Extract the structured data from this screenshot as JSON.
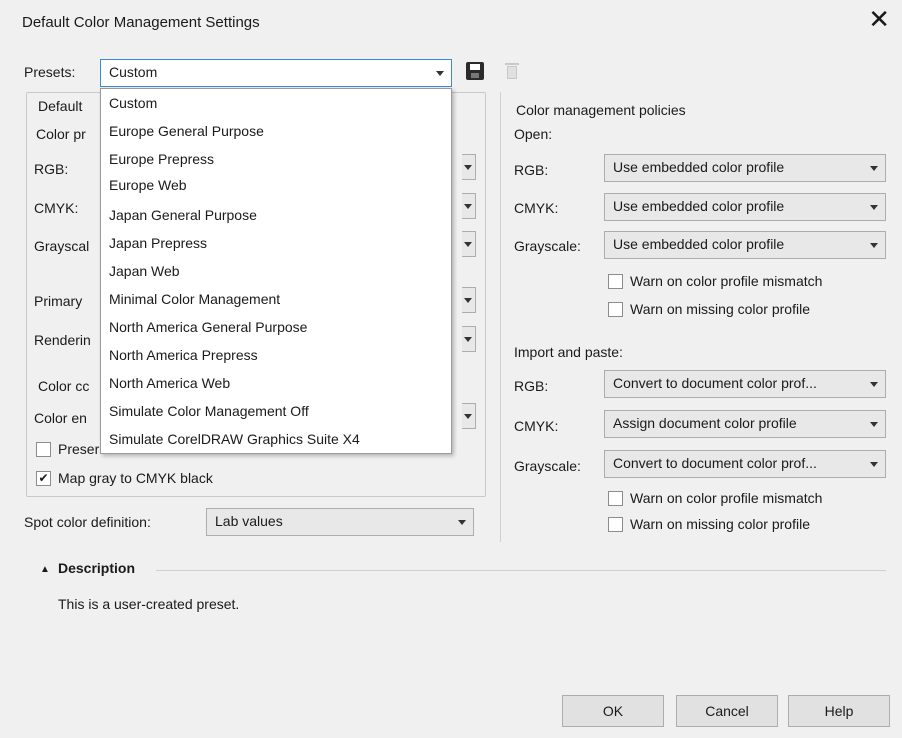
{
  "window": {
    "title": "Default Color Management Settings",
    "close_glyph": "✕"
  },
  "presets": {
    "label": "Presets:",
    "value": "Custom",
    "options": [
      "Custom",
      "Europe General Purpose",
      "Europe Prepress",
      "Europe Web",
      "Japan General Purpose",
      "Japan Prepress",
      "Japan Web",
      "Minimal Color Management",
      "North America General Purpose",
      "North America Prepress",
      "North America Web",
      "Simulate Color Management Off",
      "Simulate CorelDRAW Graphics Suite X4"
    ]
  },
  "left": {
    "default_fragment": "Default",
    "color_profiles_fragment": "Color pr",
    "rgb": "RGB:",
    "cmyk": "CMYK:",
    "grayscale_fragment": "Grayscal",
    "primary_fragment": "Primary",
    "rendering_fragment": "Renderin",
    "color_conv_fragment": "Color cc",
    "color_engine_fragment": "Color en",
    "preserve_fragment": "Preser",
    "map_gray": "Map gray to CMYK black",
    "map_gray_checked": "✔"
  },
  "spot": {
    "label": "Spot color definition:",
    "value": "Lab values"
  },
  "right": {
    "policies_title": "Color management policies",
    "open": "Open:",
    "rgb": "RGB:",
    "cmyk": "CMYK:",
    "grayscale": "Grayscale:",
    "open_rgb": "Use embedded color profile",
    "open_cmyk": "Use embedded color profile",
    "open_gray": "Use embedded color profile",
    "warn_mismatch": "Warn on color profile mismatch",
    "warn_missing": "Warn on missing color profile",
    "import_title": "Import and paste:",
    "import_rgb": "Convert to document color prof...",
    "import_cmyk": "Assign document color profile",
    "import_gray": "Convert to document color prof...",
    "warn_mismatch2": "Warn on color profile mismatch",
    "warn_missing2": "Warn on missing color profile"
  },
  "description": {
    "toggle": "▲",
    "title": "Description",
    "text": "This is a user-created preset."
  },
  "buttons": {
    "ok": "OK",
    "cancel": "Cancel",
    "help": "Help"
  }
}
